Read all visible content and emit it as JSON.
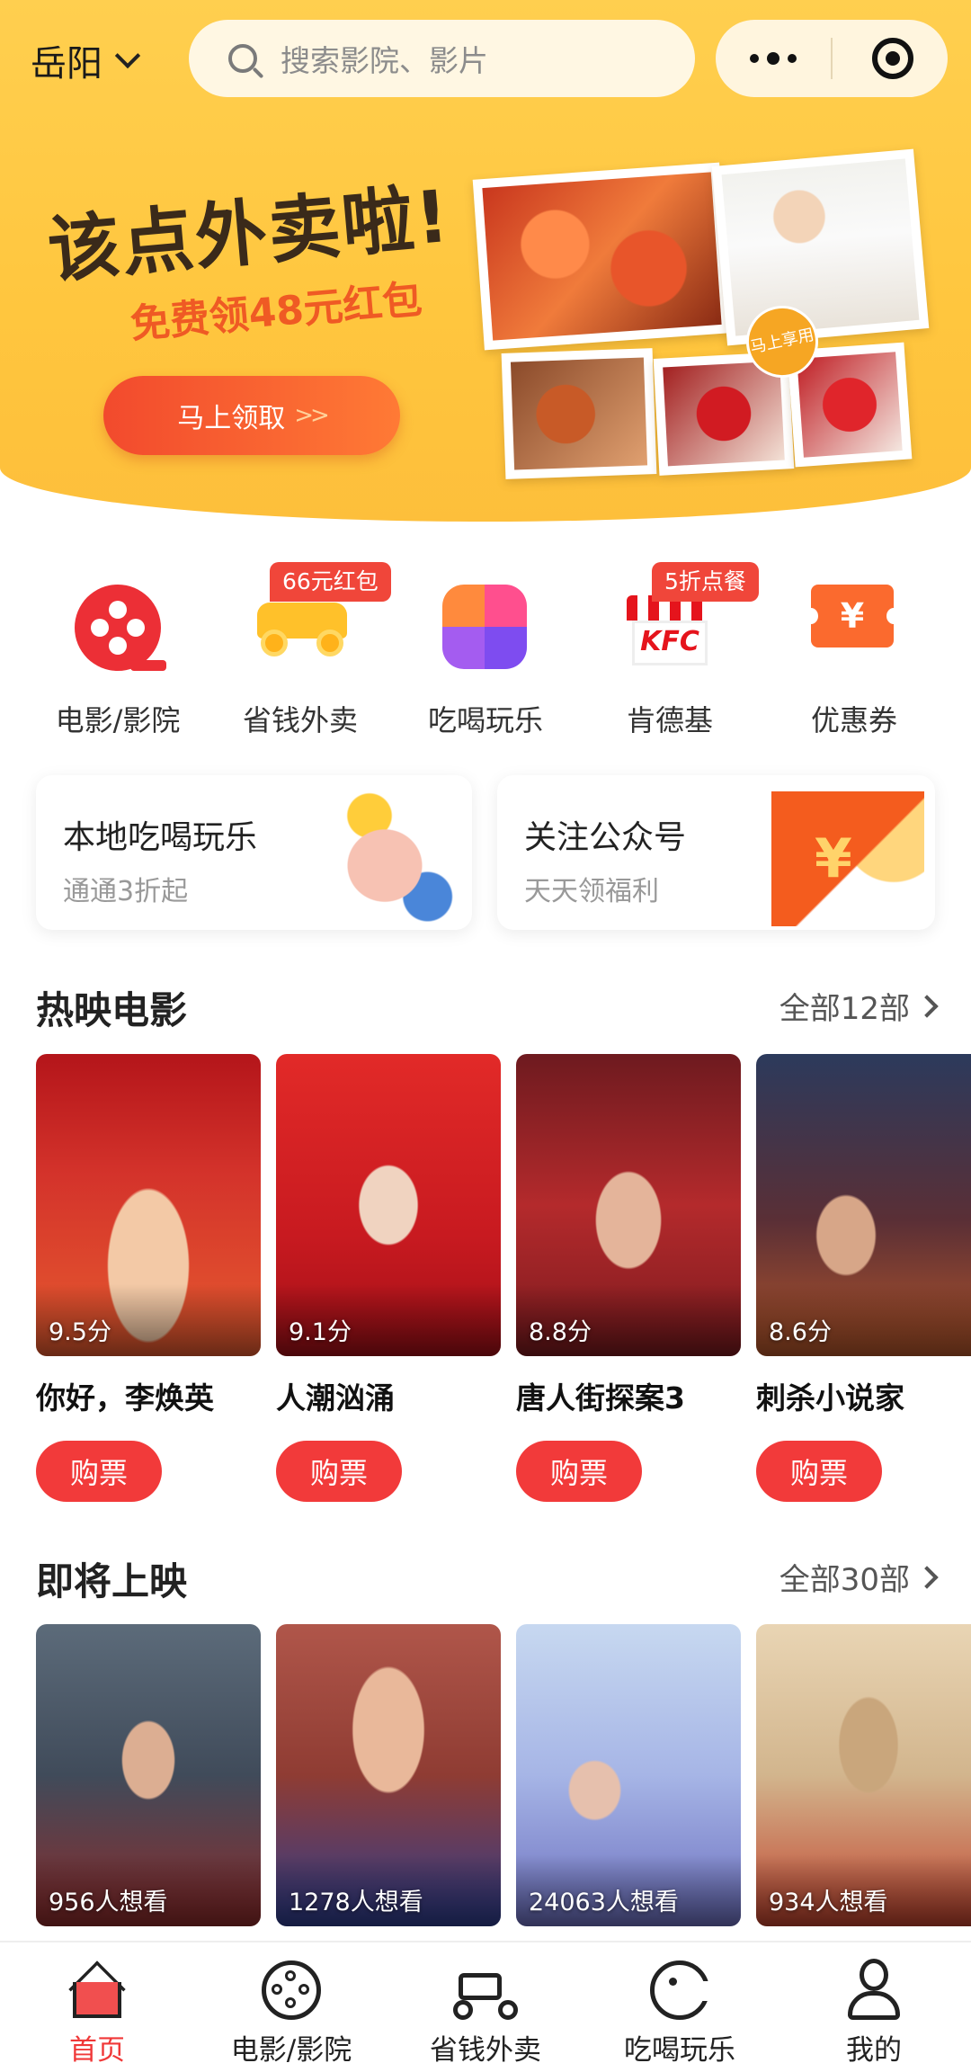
{
  "header": {
    "city": "岳阳",
    "search_placeholder": "搜索影院、影片"
  },
  "banner": {
    "title": "该点外卖啦!",
    "subtitle": "免费领48元红包",
    "button_label": "马上领取",
    "button_arrows": ">>",
    "stamp": "马上享用"
  },
  "quick_entries": [
    {
      "label": "电影/影院",
      "icon": "film-reel-icon",
      "badge": ""
    },
    {
      "label": "省钱外卖",
      "icon": "scooter-icon",
      "badge": "66元红包"
    },
    {
      "label": "吃喝玩乐",
      "icon": "food-grid-icon",
      "badge": ""
    },
    {
      "label": "肯德基",
      "icon": "kfc-store-icon",
      "badge": "5折点餐",
      "logo_text": "KFC"
    },
    {
      "label": "优惠券",
      "icon": "coupon-icon",
      "badge": "",
      "glyph": "¥"
    }
  ],
  "promo_cards": [
    {
      "title": "本地吃喝玩乐",
      "subtitle": "通通3折起"
    },
    {
      "title": "关注公众号",
      "subtitle": "天天领福利",
      "glyph": "¥"
    }
  ],
  "now_showing": {
    "heading": "热映电影",
    "more": "全部12部",
    "movies": [
      {
        "title": "你好，李焕英",
        "score": "9.5分",
        "button": "购票"
      },
      {
        "title": "人潮汹涌",
        "score": "9.1分",
        "button": "购票"
      },
      {
        "title": "唐人街探案3",
        "score": "8.8分",
        "button": "购票"
      },
      {
        "title": "刺杀小说家",
        "score": "8.6分",
        "button": "购票"
      }
    ]
  },
  "coming_soon": {
    "heading": "即将上映",
    "more": "全部30部",
    "movies": [
      {
        "wants": "956人想看"
      },
      {
        "wants": "1278人想看"
      },
      {
        "wants": "24063人想看"
      },
      {
        "wants": "934人想看"
      }
    ]
  },
  "tabbar": [
    {
      "label": "首页",
      "active": true
    },
    {
      "label": "电影/影院",
      "active": false
    },
    {
      "label": "省钱外卖",
      "active": false
    },
    {
      "label": "吃喝玩乐",
      "active": false
    },
    {
      "label": "我的",
      "active": false
    }
  ],
  "colors": {
    "header_yellow": "#ffc63e",
    "accent_red": "#f23a3a",
    "badge_red": "#f0463a",
    "banner_orange": "#ef5a24"
  }
}
